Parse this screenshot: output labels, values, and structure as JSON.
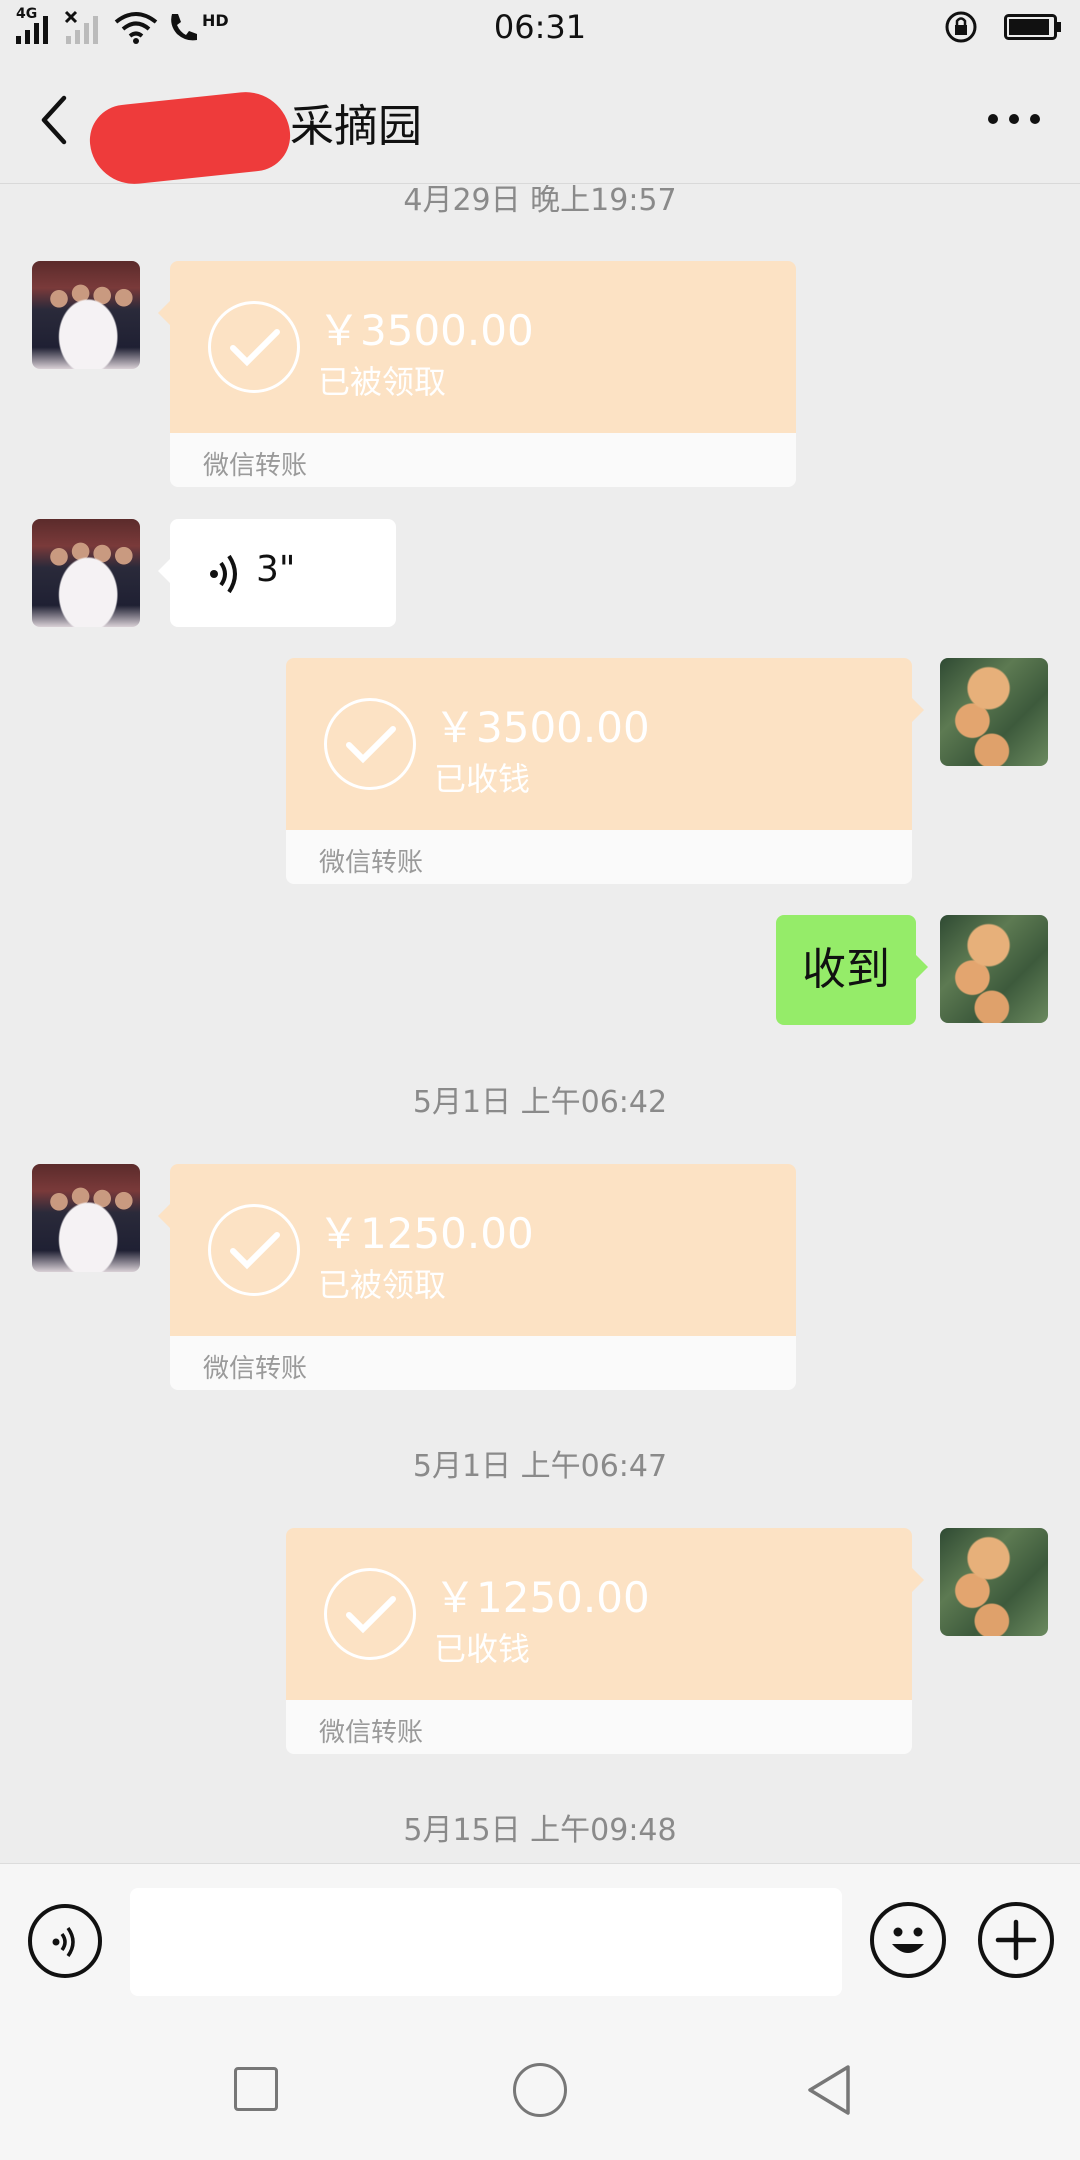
{
  "status_bar": {
    "time": "06:31",
    "network_label": "4G",
    "hd_label": "HD"
  },
  "header": {
    "title": "采摘园",
    "back_icon": "chevron-left-icon",
    "more_icon": "more-dots-icon"
  },
  "messages": {
    "ts1": "4月29日 晚上19:57",
    "m1_amount": "￥3500.00",
    "m1_status": "已被领取",
    "m1_footer": "微信转账",
    "m2_duration": "3\"",
    "m3_amount": "￥3500.00",
    "m3_status": "已收钱",
    "m3_footer": "微信转账",
    "m4_text": "收到",
    "ts2": "5月1日 上午06:42",
    "m5_amount": "￥1250.00",
    "m5_status": "已被领取",
    "m5_footer": "微信转账",
    "ts3": "5月1日 上午06:47",
    "m6_amount": "￥1250.00",
    "m6_status": "已收钱",
    "m6_footer": "微信转账",
    "ts4": "5月15日 上午09:48"
  },
  "input_bar": {
    "placeholder": "",
    "icons": [
      "voice-icon",
      "emoji-icon",
      "plus-icon"
    ]
  },
  "colors": {
    "transfer_bg": "#fce2c4",
    "sent_text_bg": "#95ec69",
    "background": "#ededed"
  }
}
